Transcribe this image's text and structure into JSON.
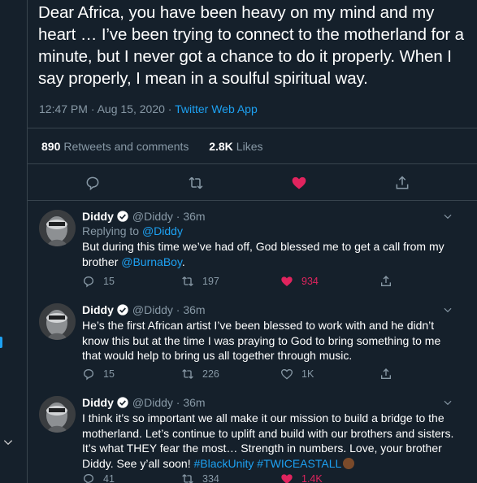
{
  "tweet": {
    "text": "Dear Africa, you have been heavy on my mind and my heart … I’ve been trying to connect to the motherland for a minute, but I never got a chance to do it properly. When I say properly, I mean in a soulful spiritual way.",
    "timestamp": "12:47 PM · Aug 15, 2020 · ",
    "app": "Twitter Web App",
    "retweets_count": "890",
    "retweets_label": "Retweets and comments",
    "likes_count": "2.8K",
    "likes_label": "Likes"
  },
  "replies": [
    {
      "name": "Diddy",
      "handle": "@Diddy · 36m",
      "replying_label": "Replying to ",
      "replying_to": "@Diddy",
      "text_a": "But during this time we’ve had off, God blessed me to get a call from my brother ",
      "mention": "@BurnaBoy",
      "text_b": ".",
      "replies": "15",
      "retweets": "197",
      "likes": "934"
    },
    {
      "name": "Diddy",
      "handle": "@Diddy · 36m",
      "text": "He’s the first African artist I’ve been blessed to work with and he didn’t know this but at the time I was praying to God to bring something to me that would help to bring us all together through music.",
      "replies": "15",
      "retweets": "226",
      "likes": "1K"
    },
    {
      "name": "Diddy",
      "handle": "@Diddy · 36m",
      "text": "I think it’s so important we all make it our mission to build a bridge to the motherland. Let’s continue to uplift and build with our brothers and sisters. It’s what THEY fear the most… Strength in numbers. Love, your brother Diddy. See y’all soon! ",
      "hashtag1": "#BlackUnity",
      "hashtag2": "#TWICEASTALL",
      "replies": "41",
      "retweets": "334",
      "likes": "1.4K"
    }
  ],
  "colors": {
    "background": "#15202b",
    "border": "#38444d",
    "muted": "#8899a6",
    "link": "#1da1f2",
    "like": "#e0245e"
  },
  "icons": [
    "reply-icon",
    "retweet-icon",
    "like-icon",
    "share-icon",
    "verified-icon",
    "chevron-down-icon"
  ]
}
